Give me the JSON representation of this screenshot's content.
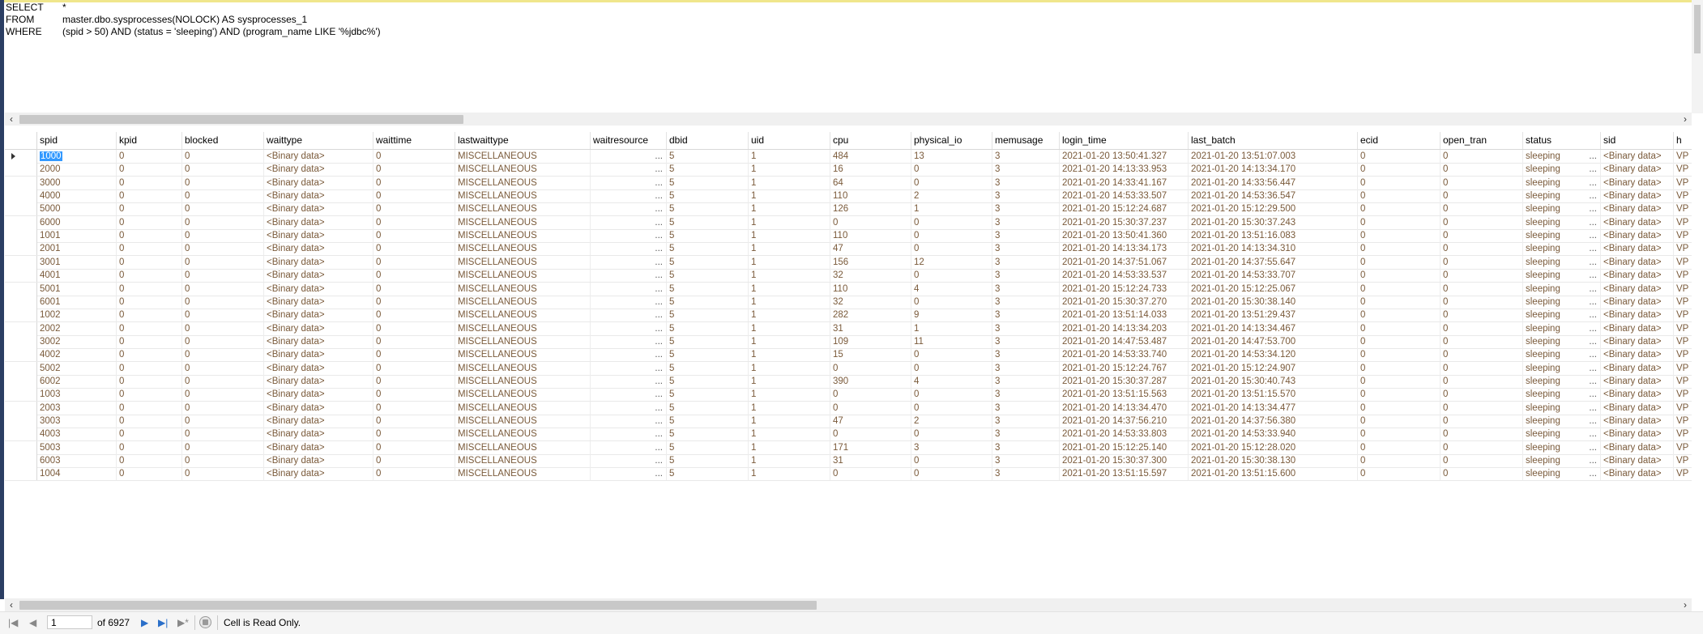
{
  "sql": {
    "lines": [
      {
        "kw": "SELECT",
        "text": "*"
      },
      {
        "kw": "FROM",
        "text": "master.dbo.sysprocesses(NOLOCK) AS sysprocesses_1"
      },
      {
        "kw": "WHERE",
        "text": "(spid > 50) AND (status = 'sleeping') AND (program_name LIKE '%jdbc%')"
      }
    ]
  },
  "columns": [
    "spid",
    "kpid",
    "blocked",
    "waittype",
    "waittime",
    "lastwaittype",
    "waitresource",
    "dbid",
    "uid",
    "cpu",
    "physical_io",
    "memusage",
    "login_time",
    "last_batch",
    "ecid",
    "open_tran",
    "status",
    "sid",
    "h"
  ],
  "rows": [
    [
      "1000",
      "0",
      "0",
      "<Binary data>",
      "0",
      "MISCELLANEOUS",
      "",
      "5",
      "1",
      "484",
      "13",
      "3",
      "2021-01-20 13:50:41.327",
      "2021-01-20 13:51:07.003",
      "0",
      "0",
      "sleeping",
      "<Binary data>",
      "VP"
    ],
    [
      "2000",
      "0",
      "0",
      "<Binary data>",
      "0",
      "MISCELLANEOUS",
      "",
      "5",
      "1",
      "16",
      "0",
      "3",
      "2021-01-20 14:13:33.953",
      "2021-01-20 14:13:34.170",
      "0",
      "0",
      "sleeping",
      "<Binary data>",
      "VP"
    ],
    [
      "3000",
      "0",
      "0",
      "<Binary data>",
      "0",
      "MISCELLANEOUS",
      "",
      "5",
      "1",
      "64",
      "0",
      "3",
      "2021-01-20 14:33:41.167",
      "2021-01-20 14:33:56.447",
      "0",
      "0",
      "sleeping",
      "<Binary data>",
      "VP"
    ],
    [
      "4000",
      "0",
      "0",
      "<Binary data>",
      "0",
      "MISCELLANEOUS",
      "",
      "5",
      "1",
      "110",
      "2",
      "3",
      "2021-01-20 14:53:33.507",
      "2021-01-20 14:53:36.547",
      "0",
      "0",
      "sleeping",
      "<Binary data>",
      "VP"
    ],
    [
      "5000",
      "0",
      "0",
      "<Binary data>",
      "0",
      "MISCELLANEOUS",
      "",
      "5",
      "1",
      "126",
      "1",
      "3",
      "2021-01-20 15:12:24.687",
      "2021-01-20 15:12:29.500",
      "0",
      "0",
      "sleeping",
      "<Binary data>",
      "VP"
    ],
    [
      "6000",
      "0",
      "0",
      "<Binary data>",
      "0",
      "MISCELLANEOUS",
      "",
      "5",
      "1",
      "0",
      "0",
      "3",
      "2021-01-20 15:30:37.237",
      "2021-01-20 15:30:37.243",
      "0",
      "0",
      "sleeping",
      "<Binary data>",
      "VP"
    ],
    [
      "1001",
      "0",
      "0",
      "<Binary data>",
      "0",
      "MISCELLANEOUS",
      "",
      "5",
      "1",
      "110",
      "0",
      "3",
      "2021-01-20 13:50:41.360",
      "2021-01-20 13:51:16.083",
      "0",
      "0",
      "sleeping",
      "<Binary data>",
      "VP"
    ],
    [
      "2001",
      "0",
      "0",
      "<Binary data>",
      "0",
      "MISCELLANEOUS",
      "",
      "5",
      "1",
      "47",
      "0",
      "3",
      "2021-01-20 14:13:34.173",
      "2021-01-20 14:13:34.310",
      "0",
      "0",
      "sleeping",
      "<Binary data>",
      "VP"
    ],
    [
      "3001",
      "0",
      "0",
      "<Binary data>",
      "0",
      "MISCELLANEOUS",
      "",
      "5",
      "1",
      "156",
      "12",
      "3",
      "2021-01-20 14:37:51.067",
      "2021-01-20 14:37:55.647",
      "0",
      "0",
      "sleeping",
      "<Binary data>",
      "VP"
    ],
    [
      "4001",
      "0",
      "0",
      "<Binary data>",
      "0",
      "MISCELLANEOUS",
      "",
      "5",
      "1",
      "32",
      "0",
      "3",
      "2021-01-20 14:53:33.537",
      "2021-01-20 14:53:33.707",
      "0",
      "0",
      "sleeping",
      "<Binary data>",
      "VP"
    ],
    [
      "5001",
      "0",
      "0",
      "<Binary data>",
      "0",
      "MISCELLANEOUS",
      "",
      "5",
      "1",
      "110",
      "4",
      "3",
      "2021-01-20 15:12:24.733",
      "2021-01-20 15:12:25.067",
      "0",
      "0",
      "sleeping",
      "<Binary data>",
      "VP"
    ],
    [
      "6001",
      "0",
      "0",
      "<Binary data>",
      "0",
      "MISCELLANEOUS",
      "",
      "5",
      "1",
      "32",
      "0",
      "3",
      "2021-01-20 15:30:37.270",
      "2021-01-20 15:30:38.140",
      "0",
      "0",
      "sleeping",
      "<Binary data>",
      "VP"
    ],
    [
      "1002",
      "0",
      "0",
      "<Binary data>",
      "0",
      "MISCELLANEOUS",
      "",
      "5",
      "1",
      "282",
      "9",
      "3",
      "2021-01-20 13:51:14.033",
      "2021-01-20 13:51:29.437",
      "0",
      "0",
      "sleeping",
      "<Binary data>",
      "VP"
    ],
    [
      "2002",
      "0",
      "0",
      "<Binary data>",
      "0",
      "MISCELLANEOUS",
      "",
      "5",
      "1",
      "31",
      "1",
      "3",
      "2021-01-20 14:13:34.203",
      "2021-01-20 14:13:34.467",
      "0",
      "0",
      "sleeping",
      "<Binary data>",
      "VP"
    ],
    [
      "3002",
      "0",
      "0",
      "<Binary data>",
      "0",
      "MISCELLANEOUS",
      "",
      "5",
      "1",
      "109",
      "11",
      "3",
      "2021-01-20 14:47:53.487",
      "2021-01-20 14:47:53.700",
      "0",
      "0",
      "sleeping",
      "<Binary data>",
      "VP"
    ],
    [
      "4002",
      "0",
      "0",
      "<Binary data>",
      "0",
      "MISCELLANEOUS",
      "",
      "5",
      "1",
      "15",
      "0",
      "3",
      "2021-01-20 14:53:33.740",
      "2021-01-20 14:53:34.120",
      "0",
      "0",
      "sleeping",
      "<Binary data>",
      "VP"
    ],
    [
      "5002",
      "0",
      "0",
      "<Binary data>",
      "0",
      "MISCELLANEOUS",
      "",
      "5",
      "1",
      "0",
      "0",
      "3",
      "2021-01-20 15:12:24.767",
      "2021-01-20 15:12:24.907",
      "0",
      "0",
      "sleeping",
      "<Binary data>",
      "VP"
    ],
    [
      "6002",
      "0",
      "0",
      "<Binary data>",
      "0",
      "MISCELLANEOUS",
      "",
      "5",
      "1",
      "390",
      "4",
      "3",
      "2021-01-20 15:30:37.287",
      "2021-01-20 15:30:40.743",
      "0",
      "0",
      "sleeping",
      "<Binary data>",
      "VP"
    ],
    [
      "1003",
      "0",
      "0",
      "<Binary data>",
      "0",
      "MISCELLANEOUS",
      "",
      "5",
      "1",
      "0",
      "0",
      "3",
      "2021-01-20 13:51:15.563",
      "2021-01-20 13:51:15.570",
      "0",
      "0",
      "sleeping",
      "<Binary data>",
      "VP"
    ],
    [
      "2003",
      "0",
      "0",
      "<Binary data>",
      "0",
      "MISCELLANEOUS",
      "",
      "5",
      "1",
      "0",
      "0",
      "3",
      "2021-01-20 14:13:34.470",
      "2021-01-20 14:13:34.477",
      "0",
      "0",
      "sleeping",
      "<Binary data>",
      "VP"
    ],
    [
      "3003",
      "0",
      "0",
      "<Binary data>",
      "0",
      "MISCELLANEOUS",
      "",
      "5",
      "1",
      "47",
      "2",
      "3",
      "2021-01-20 14:37:56.210",
      "2021-01-20 14:37:56.380",
      "0",
      "0",
      "sleeping",
      "<Binary data>",
      "VP"
    ],
    [
      "4003",
      "0",
      "0",
      "<Binary data>",
      "0",
      "MISCELLANEOUS",
      "",
      "5",
      "1",
      "0",
      "0",
      "3",
      "2021-01-20 14:53:33.803",
      "2021-01-20 14:53:33.940",
      "0",
      "0",
      "sleeping",
      "<Binary data>",
      "VP"
    ],
    [
      "5003",
      "0",
      "0",
      "<Binary data>",
      "0",
      "MISCELLANEOUS",
      "",
      "5",
      "1",
      "171",
      "3",
      "3",
      "2021-01-20 15:12:25.140",
      "2021-01-20 15:12:28.020",
      "0",
      "0",
      "sleeping",
      "<Binary data>",
      "VP"
    ],
    [
      "6003",
      "0",
      "0",
      "<Binary data>",
      "0",
      "MISCELLANEOUS",
      "",
      "5",
      "1",
      "31",
      "0",
      "3",
      "2021-01-20 15:30:37.300",
      "2021-01-20 15:30:38.130",
      "0",
      "0",
      "sleeping",
      "<Binary data>",
      "VP"
    ],
    [
      "1004",
      "0",
      "0",
      "<Binary data>",
      "0",
      "MISCELLANEOUS",
      "",
      "5",
      "1",
      "0",
      "0",
      "3",
      "2021-01-20 13:51:15.597",
      "2021-01-20 13:51:15.600",
      "0",
      "0",
      "sleeping",
      "<Binary data>",
      "VP"
    ]
  ],
  "ellipsis": "...",
  "pager": {
    "current": "1",
    "of_label": "of 6927",
    "first_icon": "first-record-icon",
    "prev_icon": "previous-record-icon",
    "next_icon": "next-record-icon",
    "last_icon": "last-record-icon",
    "new_icon": "new-record-icon",
    "stop_icon": "stop-icon"
  },
  "status_text": "Cell is Read Only.",
  "colors": {
    "cell_text": "#7a5a3a",
    "selection": "#3399ff",
    "nav_blue": "#2a6fc9"
  }
}
